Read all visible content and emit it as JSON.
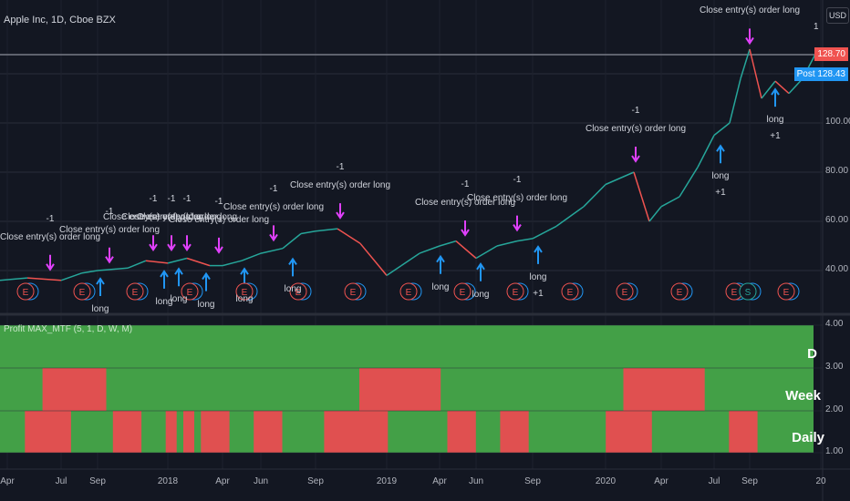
{
  "header": {
    "symbol_title": "Apple Inc, 1D, Cboe BZX",
    "currency": "USD"
  },
  "price_scale": {
    "ticks": [
      "40.00",
      "60.00",
      "80.00",
      "100.00"
    ],
    "top_cut": "1",
    "last_price": "128.70",
    "post_label": "Post",
    "post_price": "128.43",
    "colors": {
      "last": "#f05350",
      "post": "#2196f3"
    }
  },
  "time_axis": {
    "ticks": [
      "Apr",
      "Jul",
      "Sep",
      "2018",
      "Apr",
      "Jun",
      "Sep",
      "2019",
      "Apr",
      "Jun",
      "Sep",
      "2020",
      "Apr",
      "Jul",
      "Sep",
      "20"
    ]
  },
  "prices": [
    [
      0,
      36
    ],
    [
      30,
      37
    ],
    [
      67,
      36
    ],
    [
      90,
      39
    ],
    [
      107,
      40
    ],
    [
      140,
      41
    ],
    [
      160,
      44
    ],
    [
      184,
      43
    ],
    [
      205,
      45
    ],
    [
      230,
      42
    ],
    [
      244,
      42
    ],
    [
      265,
      44
    ],
    [
      286,
      47
    ],
    [
      310,
      49
    ],
    [
      330,
      55
    ],
    [
      346,
      56
    ],
    [
      370,
      57
    ],
    [
      395,
      51
    ],
    [
      424,
      38
    ],
    [
      440,
      42
    ],
    [
      460,
      47
    ],
    [
      482,
      50
    ],
    [
      500,
      52
    ],
    [
      522,
      45
    ],
    [
      545,
      50
    ],
    [
      567,
      52
    ],
    [
      584,
      53
    ],
    [
      610,
      58
    ],
    [
      640,
      66
    ],
    [
      664,
      75
    ],
    [
      695,
      80
    ],
    [
      712,
      60
    ],
    [
      725,
      66
    ],
    [
      745,
      70
    ],
    [
      765,
      82
    ],
    [
      783,
      95
    ],
    [
      800,
      100
    ],
    [
      812,
      118
    ],
    [
      822,
      130
    ],
    [
      835,
      110
    ],
    [
      850,
      117
    ],
    [
      865,
      112
    ],
    [
      880,
      118
    ],
    [
      895,
      128.7
    ]
  ],
  "signals": {
    "close_label": "Close entry(s) order long",
    "close_qty": "-1",
    "long_label": "long",
    "long_qty": "+1",
    "closes": [
      [
        55,
        36
      ],
      [
        120,
        39
      ],
      [
        168,
        44
      ],
      [
        188,
        44
      ],
      [
        205,
        44
      ],
      [
        240,
        43
      ],
      [
        300,
        48
      ],
      [
        373,
        57
      ],
      [
        510,
        50
      ],
      [
        567,
        52
      ],
      [
        697,
        80
      ],
      [
        822,
        128
      ]
    ],
    "longs": [
      [
        110,
        40,
        false
      ],
      [
        180,
        43,
        false
      ],
      [
        196,
        44,
        false
      ],
      [
        226,
        42,
        false
      ],
      [
        268,
        44,
        false
      ],
      [
        321,
        48,
        false
      ],
      [
        483,
        49,
        false
      ],
      [
        527,
        46,
        false
      ],
      [
        590,
        53,
        true
      ],
      [
        790,
        94,
        true
      ],
      [
        850,
        117,
        true
      ]
    ]
  },
  "events": [
    [
      "E",
      28
    ],
    [
      "E",
      90
    ],
    [
      "E",
      148
    ],
    [
      "E",
      208
    ],
    [
      "E",
      268
    ],
    [
      "E",
      327
    ],
    [
      "E",
      387
    ],
    [
      "E",
      448
    ],
    [
      "E",
      507
    ],
    [
      "E",
      565
    ],
    [
      "E",
      625
    ],
    [
      "E",
      685
    ],
    [
      "E",
      745
    ],
    [
      "E",
      805
    ],
    [
      "S",
      820
    ],
    [
      "E",
      862
    ]
  ],
  "indicator": {
    "title": "Profit MAX_MTF (5, 1, D, W, M)",
    "ticks": [
      "4.00",
      "3.00",
      "2.00",
      "1.00"
    ],
    "row_labels": [
      "D",
      "Week",
      "Daily"
    ],
    "colors": {
      "bull": "#43a047",
      "bear": "#e05050"
    },
    "weekly_bear_periods": [
      [
        "Jun 2017",
        "Sep 2017"
      ],
      [
        "Dec 2018",
        "Apr 2019"
      ],
      [
        "Mar 2020",
        "Jul 2020"
      ]
    ],
    "daily_bear_periods": [
      [
        "May 2017",
        "Jul 2017"
      ],
      [
        "Oct 2017",
        "Nov 2017"
      ],
      [
        "Jan 2018",
        "Jan 2018"
      ],
      [
        "Feb 2018",
        "Feb 2018"
      ],
      [
        "Mar 2018",
        "Apr 2018"
      ],
      [
        "Jun 2018",
        "Jul 2018"
      ],
      [
        "Oct 2018",
        "Jan 2019"
      ],
      [
        "May 2019",
        "Jun 2019"
      ],
      [
        "Aug 2019",
        "Sep 2019"
      ],
      [
        "Feb 2020",
        "Apr 2020"
      ],
      [
        "Sep 2020",
        "Oct 2020"
      ]
    ]
  }
}
